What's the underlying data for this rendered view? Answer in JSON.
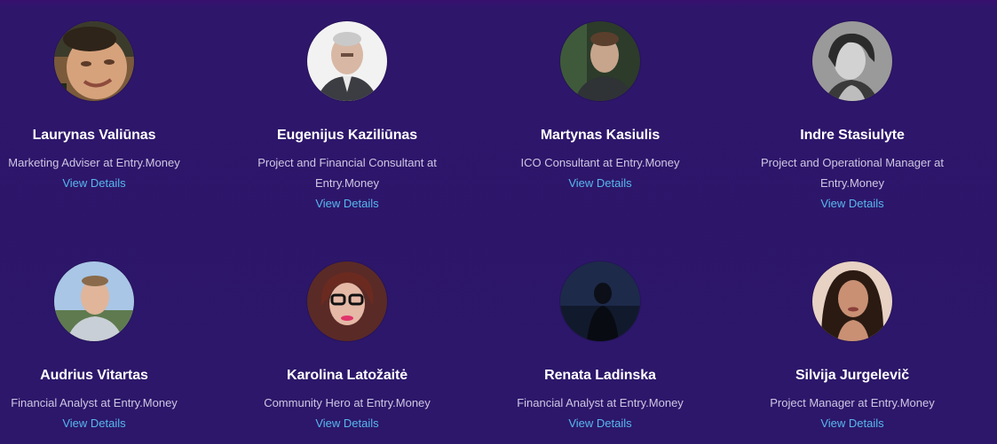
{
  "team": {
    "members": [
      {
        "name": "Laurynas Valiūnas",
        "role": "Marketing Adviser at Entry.Money",
        "link": "View Details"
      },
      {
        "name": "Eugenijus Kaziliūnas",
        "role": "Project and Financial Consultant at Entry.Money",
        "link": "View Details"
      },
      {
        "name": "Martynas Kasiulis",
        "role": "ICO Consultant at Entry.Money",
        "link": "View Details"
      },
      {
        "name": "Indre Stasiulyte",
        "role": "Project and Operational Manager at Entry.Money",
        "link": "View Details"
      },
      {
        "name": "Audrius Vitartas",
        "role": "Financial Analyst at Entry.Money",
        "link": "View Details"
      },
      {
        "name": "Karolina Latožaitė",
        "role": "Community Hero at Entry.Money",
        "link": "View Details"
      },
      {
        "name": "Renata Ladinska",
        "role": "Financial Analyst at Entry.Money",
        "link": "View Details"
      },
      {
        "name": "Silvija Jurgelevič",
        "role": "Project Manager at Entry.Money",
        "link": "View Details"
      }
    ]
  },
  "colors": {
    "background": "#2d1668",
    "name_text": "#ffffff",
    "role_text": "#cfc6e3",
    "link": "#58b7ee"
  }
}
